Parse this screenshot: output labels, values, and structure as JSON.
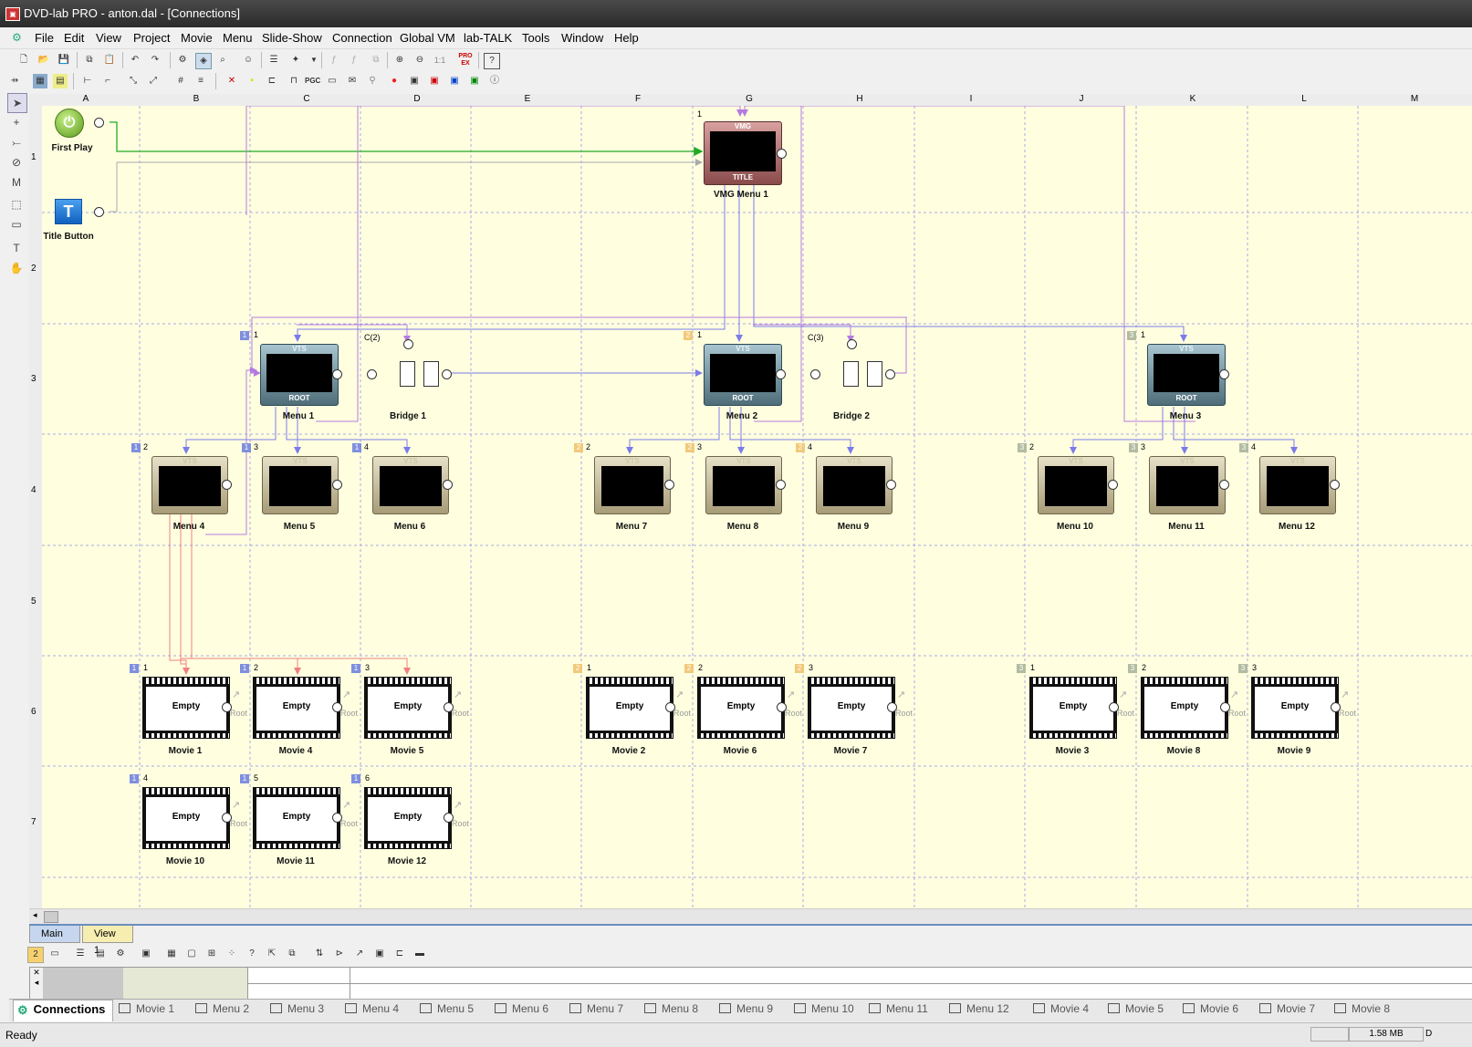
{
  "window": {
    "title": "DVD-lab PRO - anton.dal - [Connections]"
  },
  "menubar": [
    "File",
    "Edit",
    "View",
    "Project",
    "Movie",
    "Menu",
    "Slide-Show",
    "Connection",
    "Global VM",
    "lab-TALK",
    "Tools",
    "Window",
    "Help"
  ],
  "toolbar": {
    "pgc": "PGC",
    "pro": "PRO EX",
    "zoom": "1:1"
  },
  "grid": {
    "columns": [
      "A",
      "B",
      "C",
      "D",
      "E",
      "F",
      "G",
      "H",
      "I",
      "J",
      "K",
      "L",
      "M"
    ],
    "rows": [
      "1",
      "2",
      "3",
      "4",
      "5",
      "6",
      "7"
    ]
  },
  "nodes": {
    "first_play": "First Play",
    "title_button": "Title Button",
    "vmg": {
      "number": "1",
      "label": "VMG Menu 1",
      "top": "VMG",
      "bottom": "TITLE"
    },
    "vts_tag": "VTS",
    "root_tag": "ROOT",
    "bridge1": {
      "label": "Bridge 1",
      "tag": "C(2)"
    },
    "bridge2": {
      "label": "Bridge 2",
      "tag": "C(3)"
    },
    "root_menus": [
      {
        "vts": "1",
        "num": "1",
        "label": "Menu 1",
        "color": "#7f8fdd"
      },
      {
        "vts": "2",
        "num": "1",
        "label": "Menu 2",
        "color": "#f2c97a"
      },
      {
        "vts": "3",
        "num": "1",
        "label": "Menu 3",
        "color": "#b2bca0"
      }
    ],
    "sub_menus": [
      {
        "vts": "1",
        "num": "2",
        "label": "Menu 4",
        "color": "#7f8fdd"
      },
      {
        "vts": "1",
        "num": "3",
        "label": "Menu 5",
        "color": "#7f8fdd"
      },
      {
        "vts": "1",
        "num": "4",
        "label": "Menu 6",
        "color": "#7f8fdd"
      },
      {
        "vts": "2",
        "num": "2",
        "label": "Menu 7",
        "color": "#f2c97a"
      },
      {
        "vts": "2",
        "num": "3",
        "label": "Menu 8",
        "color": "#f2c97a"
      },
      {
        "vts": "2",
        "num": "4",
        "label": "Menu 9",
        "color": "#f2c97a"
      },
      {
        "vts": "3",
        "num": "2",
        "label": "Menu 10",
        "color": "#b2bca0"
      },
      {
        "vts": "3",
        "num": "3",
        "label": "Menu 11",
        "color": "#b2bca0"
      },
      {
        "vts": "3",
        "num": "4",
        "label": "Menu 12",
        "color": "#b2bca0"
      }
    ],
    "movie_empty": "Empty",
    "movie_root": "Root",
    "movies": [
      {
        "vts": "1",
        "num": "1",
        "label": "Movie 1",
        "color": "#7f8fdd"
      },
      {
        "vts": "1",
        "num": "2",
        "label": "Movie 4",
        "color": "#7f8fdd"
      },
      {
        "vts": "1",
        "num": "3",
        "label": "Movie 5",
        "color": "#7f8fdd"
      },
      {
        "vts": "2",
        "num": "1",
        "label": "Movie 2",
        "color": "#f2c97a"
      },
      {
        "vts": "2",
        "num": "2",
        "label": "Movie 6",
        "color": "#f2c97a"
      },
      {
        "vts": "2",
        "num": "3",
        "label": "Movie 7",
        "color": "#f2c97a"
      },
      {
        "vts": "3",
        "num": "1",
        "label": "Movie 3",
        "color": "#b2bca0"
      },
      {
        "vts": "3",
        "num": "2",
        "label": "Movie 8",
        "color": "#b2bca0"
      },
      {
        "vts": "3",
        "num": "3",
        "label": "Movie 9",
        "color": "#b2bca0"
      },
      {
        "vts": "1",
        "num": "4",
        "label": "Movie 10",
        "color": "#7f8fdd"
      },
      {
        "vts": "1",
        "num": "5",
        "label": "Movie 11",
        "color": "#7f8fdd"
      },
      {
        "vts": "1",
        "num": "6",
        "label": "Movie 12",
        "color": "#7f8fdd"
      }
    ]
  },
  "view_tabs": [
    "Main",
    "View 1"
  ],
  "palette_badge": "2",
  "doc_tabs": [
    "Connections",
    "Movie 1",
    "Menu 2",
    "Menu 3",
    "Menu 4",
    "Menu 5",
    "Menu 6",
    "Menu 7",
    "Menu 8",
    "Menu 9",
    "Menu 10",
    "Menu 11",
    "Menu 12",
    "Movie 4",
    "Movie 5",
    "Movie 6",
    "Movie 7",
    "Movie 8"
  ],
  "status": {
    "text": "Ready",
    "memory": "1.58 MB",
    "extra": "D"
  },
  "colors": {
    "vts1": "#7f8fdd",
    "vts2": "#f2c97a",
    "vts3": "#b2bca0",
    "canvas": "#ffffe0",
    "link": "#7b7bea",
    "link2": "#b57be0",
    "movie_link": "#f08080",
    "fp_link": "#22aa22"
  }
}
